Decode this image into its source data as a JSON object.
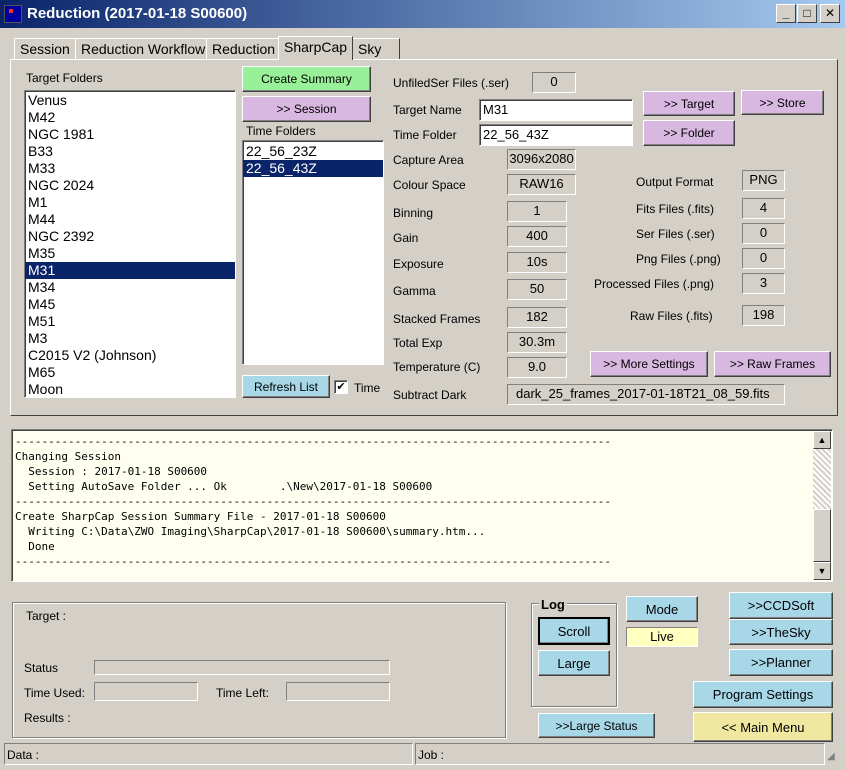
{
  "window": {
    "title": "Reduction (2017-01-18 S00600)",
    "buttons": {
      "minimize": "_",
      "maximize": "□",
      "close": "✕"
    }
  },
  "tabs": [
    "Session",
    "Reduction Workflow",
    "Reduction",
    "SharpCap",
    "Sky"
  ],
  "active_tab": "SharpCap",
  "targets": {
    "header": "Target Folders",
    "items": [
      "Venus",
      "M42",
      "NGC 1981",
      "B33",
      "M33",
      "NGC 2024",
      "M1",
      "M44",
      "NGC 2392",
      "M35",
      "M31",
      "M34",
      "M45",
      "M51",
      "M3",
      "C2015 V2 (Johnson)",
      "M65",
      "Moon"
    ],
    "selected": "M31"
  },
  "time_folders": {
    "header": "Time Folders",
    "items": [
      "22_56_23Z",
      "22_56_43Z"
    ],
    "selected": "22_56_43Z"
  },
  "buttons": {
    "create_summary": "Create Summary",
    "session": ">> Session",
    "refresh_list": "Refresh List",
    "time_checkbox_label": "Time",
    "target": ">> Target",
    "store": ">> Store",
    "folder": ">> Folder",
    "more_settings": ">> More Settings",
    "raw_frames": ">> Raw Frames"
  },
  "fields": {
    "unfiled_ser_label": "UnfiledSer Files (.ser)",
    "unfiled_ser_value": "0",
    "target_name_label": "Target Name",
    "target_name_value": "M31",
    "time_folder_label": "Time Folder",
    "time_folder_value": "22_56_43Z",
    "capture_area_label": "Capture Area",
    "capture_area_value": "3096x2080",
    "colour_space_label": "Colour Space",
    "colour_space_value": "RAW16",
    "binning_label": "Binning",
    "binning_value": "1",
    "gain_label": "Gain",
    "gain_value": "400",
    "exposure_label": "Exposure",
    "exposure_value": "10s",
    "gamma_label": "Gamma",
    "gamma_value": "50",
    "stacked_frames_label": "Stacked Frames",
    "stacked_frames_value": "182",
    "total_exp_label": "Total Exp",
    "total_exp_value": "30.3m",
    "temperature_label": "Temperature (C)",
    "temperature_value": "9.0",
    "subtract_dark_label": "Subtract Dark",
    "subtract_dark_value": "dark_25_frames_2017-01-18T21_08_59.fits"
  },
  "file_counts": {
    "output_format_label": "Output Format",
    "output_format_value": "PNG",
    "fits_label": "Fits Files (.fits)",
    "fits_value": "4",
    "ser_label": "Ser Files (.ser)",
    "ser_value": "0",
    "png_label": "Png Files (.png)",
    "png_value": "0",
    "processed_label": "Processed Files (.png)",
    "processed_value": "3",
    "raw_label": "Raw Files (.fits)",
    "raw_value": "198"
  },
  "log_text": "------------------------------------------------------------------------------------------\nChanging Session\n  Session : 2017-01-18 S00600\n  Setting AutoSave Folder ... Ok        .\\New\\2017-01-18 S00600\n------------------------------------------------------------------------------------------\nCreate SharpCap Session Summary File - 2017-01-18 S00600\n  Writing C:\\Data\\ZWO Imaging\\SharpCap\\2017-01-18 S00600\\summary.htm...\n  Done\n------------------------------------------------------------------------------------------",
  "status_panel": {
    "target_label": "Target :",
    "status_label": "Status",
    "time_used_label": "Time Used:",
    "time_left_label": "Time Left:",
    "results_label": "Results :"
  },
  "log_group": {
    "title": "Log",
    "scroll": "Scroll",
    "large": "Large"
  },
  "mode": {
    "mode_button": "Mode",
    "live_value": "Live"
  },
  "right_buttons": {
    "ccdsoft": ">>CCDSoft",
    "thesky": ">>TheSky",
    "planner": ">>Planner",
    "program_settings": "Program Settings",
    "main_menu": "<< Main Menu",
    "large_status": ">>Large Status"
  },
  "statusbar": {
    "data": "Data :",
    "job": "Job :"
  },
  "colors": {
    "titlebar_start": "#0a246a",
    "titlebar_end": "#a6caf0",
    "button_green": "#98f098",
    "button_pink": "#d8b8e0",
    "button_blue": "#a8d8e8",
    "button_yellow": "#f0e8a0",
    "selection": "#0a246a"
  }
}
